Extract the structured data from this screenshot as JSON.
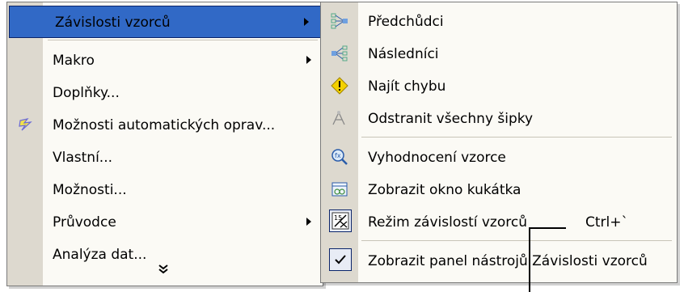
{
  "left_menu": {
    "items": [
      {
        "label": "Závislosti vzorců",
        "submenu": true,
        "selected": true,
        "icon": ""
      },
      {
        "label": "Makro",
        "submenu": true,
        "icon": ""
      },
      {
        "label": "Doplňky...",
        "submenu": false,
        "icon": ""
      },
      {
        "label": "Možnosti automatických oprav...",
        "submenu": false,
        "icon": "autocorrect-lightning-icon"
      },
      {
        "label": "Vlastní...",
        "submenu": false,
        "icon": ""
      },
      {
        "label": "Možnosti...",
        "submenu": false,
        "icon": ""
      },
      {
        "label": "Průvodce",
        "submenu": true,
        "icon": ""
      },
      {
        "label": "Analýza dat...",
        "submenu": false,
        "icon": ""
      }
    ],
    "expand_glyph": "¥"
  },
  "right_menu": {
    "items": [
      {
        "label": "Předchůdci",
        "icon": "trace-precedents-icon"
      },
      {
        "label": "Následníci",
        "icon": "trace-dependents-icon"
      },
      {
        "label": "Najít chybu",
        "icon": "trace-error-icon"
      },
      {
        "label": "Odstranit všechny šipky",
        "icon": "remove-arrows-icon"
      },
      {
        "label": "Vyhodnocení vzorce",
        "icon": "evaluate-formula-icon"
      },
      {
        "label": "Zobrazit okno kukátka",
        "icon": "watch-window-icon"
      },
      {
        "label": "Režim závislostí vzorců",
        "icon": "formula-auditing-mode-icon",
        "shortcut": "Ctrl+`"
      },
      {
        "label": "Zobrazit panel nástrojů Závislosti vzorců",
        "icon": "checkmark-icon",
        "checked": true
      }
    ]
  },
  "colors": {
    "menu_bg": "#fbfaf5",
    "gutter": "#ddd9cf",
    "highlight": "#3169c6"
  }
}
